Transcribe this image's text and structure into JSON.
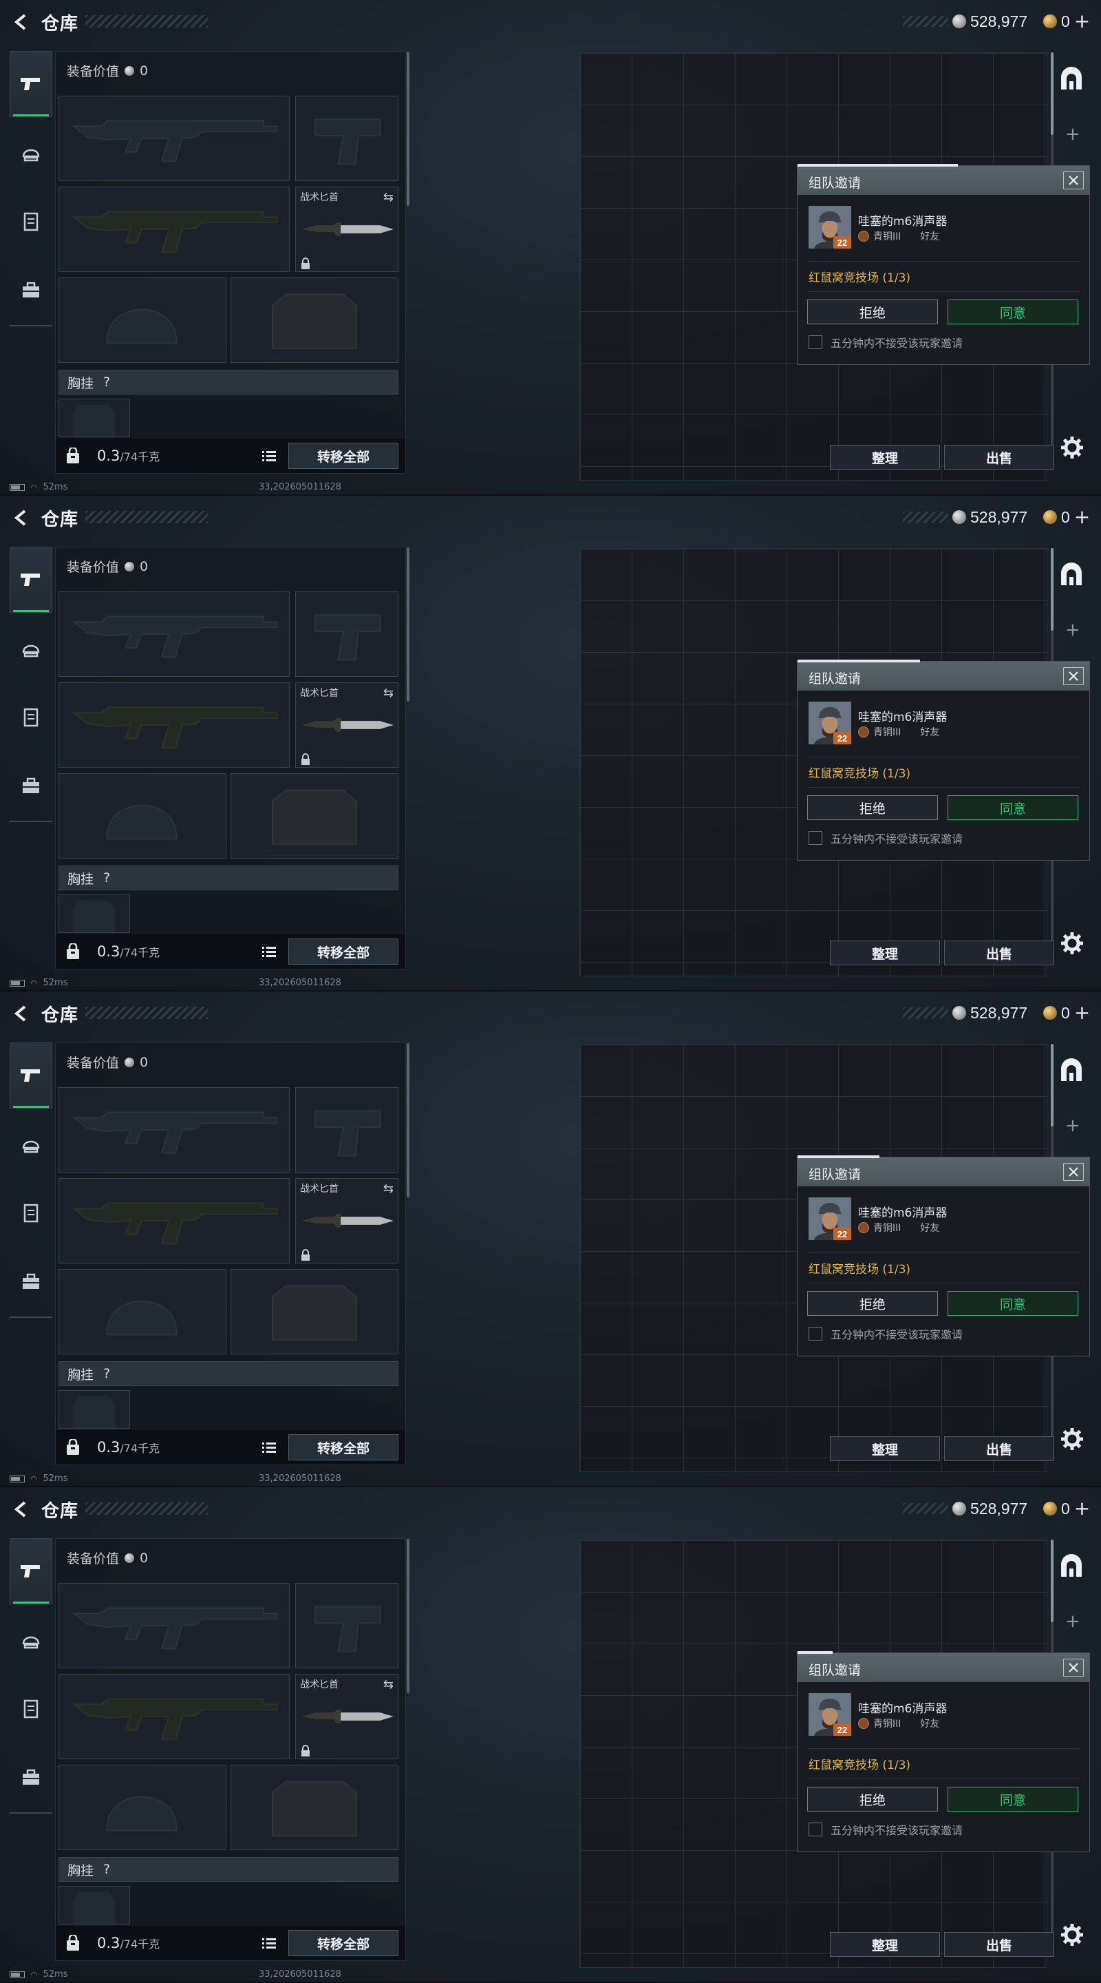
{
  "header": {
    "title": "仓库",
    "currency_silver": "528,977",
    "currency_gold": "0",
    "currency_plus": "+"
  },
  "rail": {
    "items": [
      {
        "icon": "pistol-icon",
        "active": true
      },
      {
        "icon": "helmet-icon",
        "active": false
      },
      {
        "icon": "vest-icon",
        "active": false
      },
      {
        "icon": "briefcase-icon",
        "active": false
      }
    ]
  },
  "equipment": {
    "value_label": "装备价值",
    "value": "0",
    "knife_label": "战术匕首",
    "chest_rig_label": "胸挂",
    "chest_rig_help": "?",
    "weight_value": "0.3",
    "weight_max": "/74千克",
    "transfer_all": "转移全部"
  },
  "storage": {
    "sort": "整理",
    "sell": "出售"
  },
  "status": {
    "ping": "52ms",
    "build": "33,202605011628"
  },
  "invite": {
    "title": "组队邀请",
    "player_name": "哇塞的m6消声器",
    "avatar_level": "22",
    "rank": "青铜III",
    "relation": "好友",
    "mode": "红鼠窝竞技场 (1/3)",
    "reject": "拒绝",
    "accept": "同意",
    "mute_option": "五分钟内不接受该玩家邀请"
  },
  "frames": [
    {
      "invite_progress": 0.55
    },
    {
      "invite_progress": 0.42
    },
    {
      "invite_progress": 0.28
    },
    {
      "invite_progress": 0.12
    }
  ],
  "colors": {
    "accent_green": "#39c178",
    "mode_gold": "#e1b64a"
  }
}
